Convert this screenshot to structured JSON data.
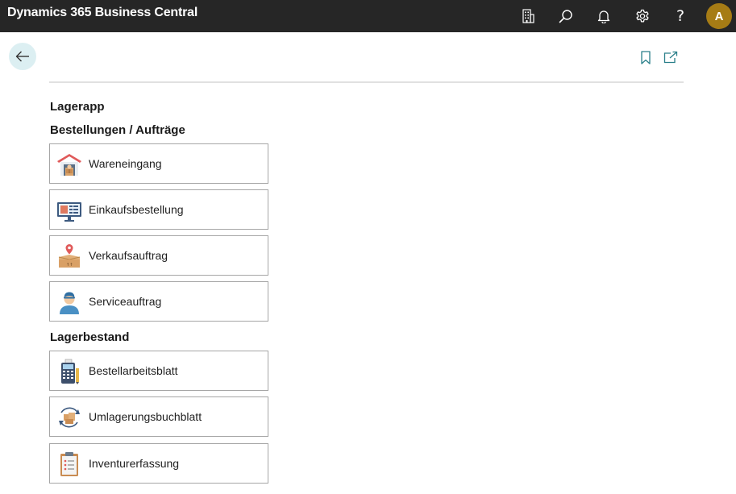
{
  "app": {
    "title": "Dynamics 365 Business Central"
  },
  "topbar": {
    "icons": [
      "building-icon",
      "search-icon",
      "bell-icon",
      "gear-icon",
      "help-icon"
    ],
    "help_glyph": "?",
    "avatar_initial": "A",
    "avatar_color": "#a67c15"
  },
  "page": {
    "title": "Lagerapp",
    "actions": [
      "bookmark-icon",
      "open-new-window-icon"
    ]
  },
  "groups": [
    {
      "title": "Bestellungen / Aufträge",
      "tiles": [
        {
          "label": "Wareneingang",
          "icon": "warehouse-receipt-icon"
        },
        {
          "label": "Einkaufsbestellung",
          "icon": "purchase-order-icon"
        },
        {
          "label": "Verkaufsauftrag",
          "icon": "sales-order-icon"
        },
        {
          "label": "Serviceauftrag",
          "icon": "service-order-icon"
        }
      ]
    },
    {
      "title": "Lagerbestand",
      "tiles": [
        {
          "label": "Bestellarbeitsblatt",
          "icon": "requisition-worksheet-icon"
        },
        {
          "label": "Umlagerungsbuchblatt",
          "icon": "reclassification-journal-icon"
        },
        {
          "label": "Inventurerfassung",
          "icon": "physical-inventory-icon"
        }
      ]
    }
  ]
}
